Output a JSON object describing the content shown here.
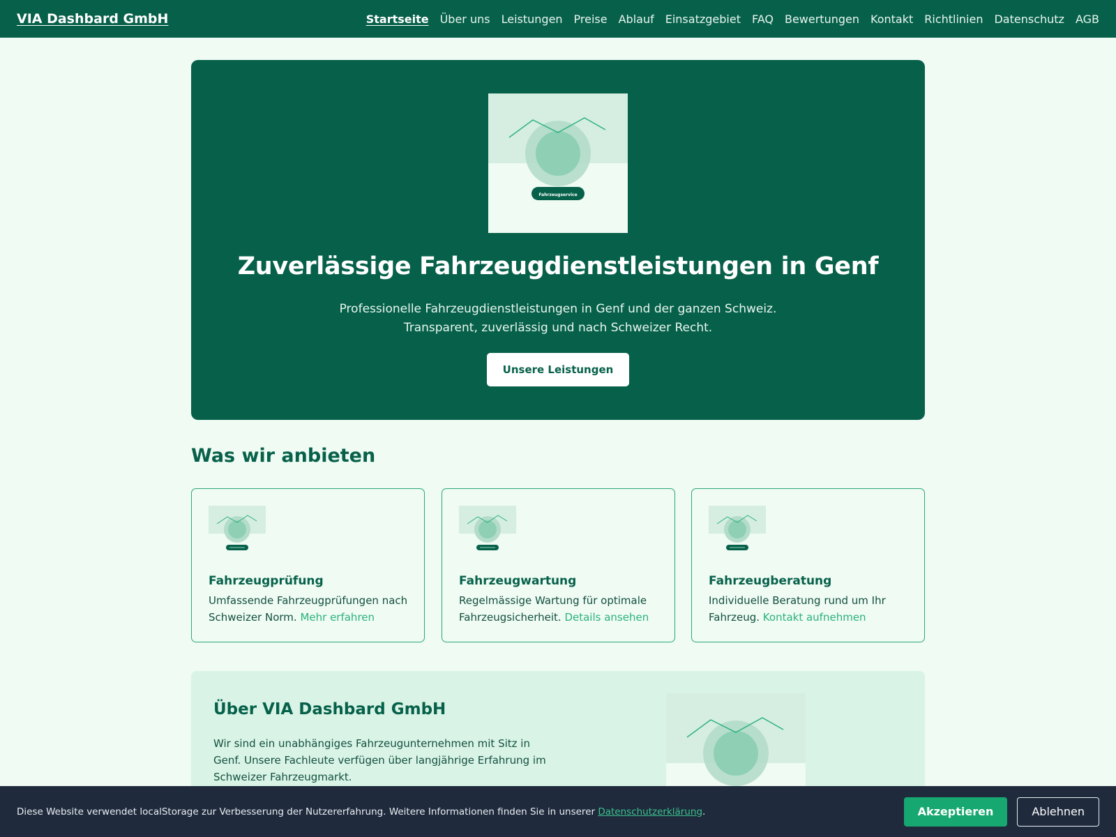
{
  "header": {
    "brand": "VIA Dashbard GmbH",
    "nav": [
      {
        "label": "Startseite",
        "active": true
      },
      {
        "label": "Über uns"
      },
      {
        "label": "Leistungen"
      },
      {
        "label": "Preise"
      },
      {
        "label": "Ablauf"
      },
      {
        "label": "Einsatzgebiet"
      },
      {
        "label": "FAQ"
      },
      {
        "label": "Bewertungen"
      },
      {
        "label": "Kontakt"
      },
      {
        "label": "Richtlinien"
      },
      {
        "label": "Datenschutz"
      },
      {
        "label": "AGB"
      }
    ]
  },
  "hero": {
    "image_badge": "Fahrzeugservice",
    "title": "Zuverlässige Fahrzeugdienstleistungen in Genf",
    "subtitle_line1": "Professionelle Fahrzeugdienstleistungen in Genf und der ganzen Schweiz.",
    "subtitle_line2": "Transparent, zuverlässig und nach Schweizer Recht.",
    "cta_label": "Unsere Leistungen"
  },
  "services": {
    "title": "Was wir anbieten",
    "cards": [
      {
        "title": "Fahrzeugprüfung",
        "text": "Umfassende Fahrzeugprüfungen nach Schweizer Norm.",
        "link": "Mehr erfahren"
      },
      {
        "title": "Fahrzeugwartung",
        "text": "Regelmässige Wartung für optimale Fahrzeugsicherheit.",
        "link": "Details ansehen"
      },
      {
        "title": "Fahrzeugberatung",
        "text": "Individuelle Beratung rund um Ihr Fahrzeug.",
        "link": "Kontakt aufnehmen"
      }
    ]
  },
  "about": {
    "title": "Über VIA Dashbard GmbH",
    "text": "Wir sind ein unabhängiges Fahrzeugunternehmen mit Sitz in Genf. Unsere Fachleute verfügen über langjährige Erfahrung im Schweizer Fahrzeugmarkt."
  },
  "cookie": {
    "text": "Diese Website verwendet localStorage zur Verbesserung der Nutzererfahrung. Weitere Informationen finden Sie in unserer",
    "link": "Datenschutzerklärung",
    "period": ".",
    "accept": "Akzeptieren",
    "decline": "Ablehnen"
  },
  "colors": {
    "primary": "#07614a",
    "accent": "#2cb27c",
    "background": "#effbf3",
    "cookie_bar": "#1f2a3c"
  }
}
